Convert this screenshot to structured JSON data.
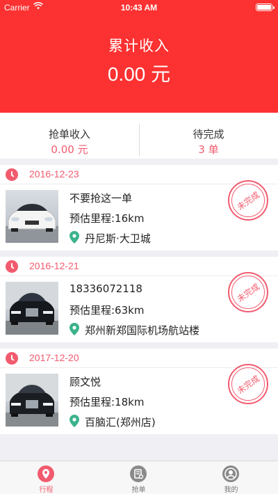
{
  "status_bar": {
    "carrier": "Carrier",
    "time": "10:43 AM"
  },
  "header": {
    "total_label": "累计收入",
    "total_value": "0.00 元"
  },
  "summary": {
    "income_label": "抢单收入",
    "income_value": "0.00 元",
    "pending_label": "待完成",
    "pending_value": "3 单"
  },
  "orders": [
    {
      "date": "2016-12-23",
      "title": "不要抢这一单",
      "distance": "预估里程:16km",
      "address": "丹尼斯·大卫城",
      "status": "未完成"
    },
    {
      "date": "2016-12-21",
      "title": "18336072118",
      "distance": "预估里程:63km",
      "address": "郑州新郑国际机场航站楼",
      "status": "未完成"
    },
    {
      "date": "2017-12-20",
      "title": "顾文悦",
      "distance": "预估里程:18km",
      "address": "百脑汇(郑州店)",
      "status": "未完成"
    }
  ],
  "tabbar": {
    "tabs": [
      {
        "label": "行程",
        "icon": "pin-icon",
        "active": true
      },
      {
        "label": "抢单",
        "icon": "grab-order-icon",
        "active": false
      },
      {
        "label": "我的",
        "icon": "profile-icon",
        "active": false
      }
    ]
  },
  "colors": {
    "header": "#fc3131",
    "accent": "#f25b6e",
    "pin": "#3bb38c"
  }
}
